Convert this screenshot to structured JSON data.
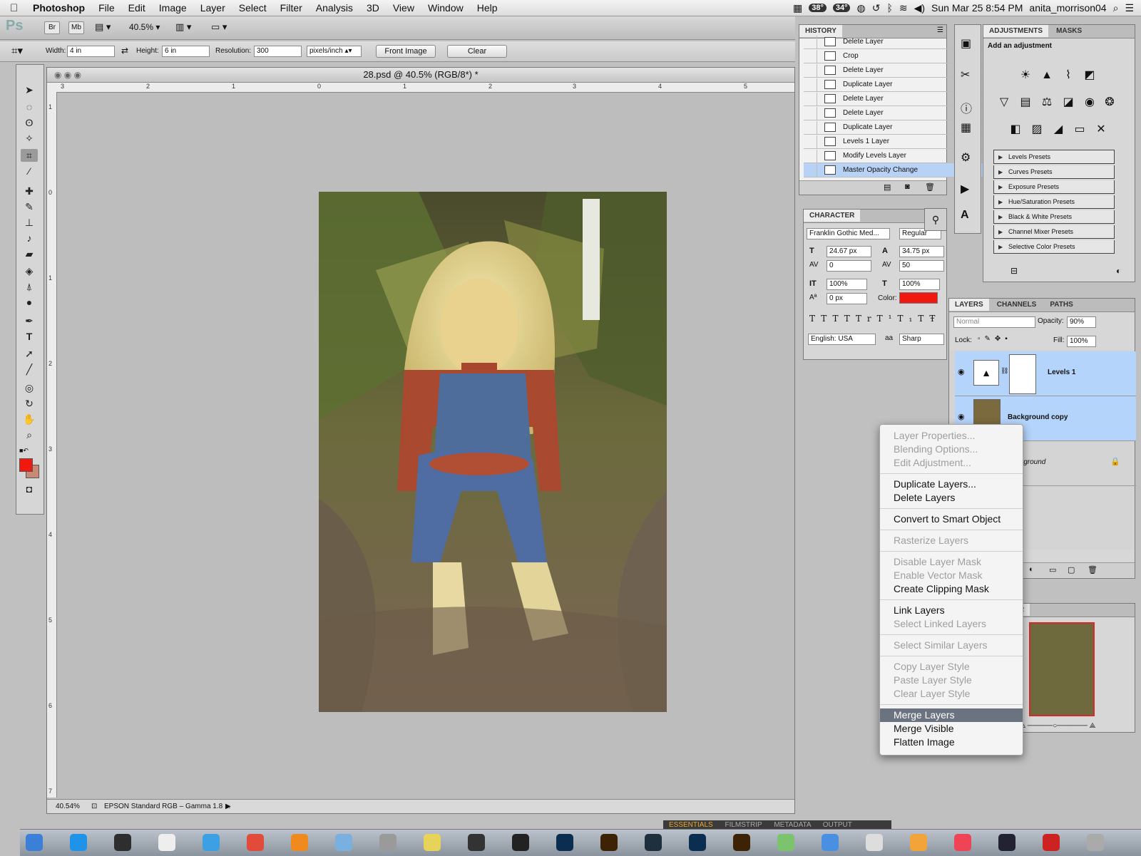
{
  "menubar": {
    "apple": "",
    "app_name": "Photoshop",
    "items": [
      "File",
      "Edit",
      "Image",
      "Layer",
      "Select",
      "Filter",
      "Analysis",
      "3D",
      "View",
      "Window",
      "Help"
    ],
    "status": {
      "temp1": "38°",
      "temp2": "34°",
      "datetime": "Sun Mar 25  8:54 PM",
      "user": "anita_morrison04"
    }
  },
  "appbar": {
    "logo": "Ps",
    "bridge": "Br",
    "minibridge": "Mb",
    "zoom": "40.5%"
  },
  "options": {
    "width_label": "Width:",
    "width_value": "4 in",
    "height_label": "Height:",
    "height_value": "6 in",
    "resolution_label": "Resolution:",
    "resolution_value": "300",
    "units": "pixels/inch",
    "front_image": "Front Image",
    "clear": "Clear"
  },
  "document": {
    "title": "28.psd @ 40.5% (RGB/8*) *",
    "ruler_h": [
      "3",
      "2",
      "1",
      "0",
      "1",
      "2",
      "3",
      "4",
      "5"
    ],
    "ruler_v": [
      "1",
      "0",
      "1",
      "2",
      "3",
      "4",
      "5",
      "6",
      "7"
    ],
    "status_zoom": "40.54%",
    "status_profile": "EPSON  Standard RGB – Gamma 1.8 ..."
  },
  "history": {
    "tab": "HISTORY",
    "items": [
      {
        "label": "Delete Layer"
      },
      {
        "label": "Crop"
      },
      {
        "label": "Delete Layer"
      },
      {
        "label": "Duplicate Layer"
      },
      {
        "label": "Delete Layer"
      },
      {
        "label": "Delete Layer"
      },
      {
        "label": "Duplicate Layer"
      },
      {
        "label": "Levels 1 Layer"
      },
      {
        "label": "Modify Levels Layer"
      },
      {
        "label": "Master Opacity Change"
      }
    ],
    "selected_index": 9
  },
  "character": {
    "tab": "CHARACTER",
    "font": "Franklin Gothic Med...",
    "style": "Regular",
    "size": "24.67 px",
    "leading": "34.75 px",
    "kerning": "0",
    "tracking": "50",
    "vscale": "100%",
    "hscale": "100%",
    "baseline": "0 px",
    "color_label": "Color:",
    "color": "#f0190f",
    "language": "English: USA",
    "aa_label": "aa",
    "antialias": "Sharp",
    "style_buttons": [
      "T",
      "T",
      "TT",
      "Tr",
      "T¹",
      "T₁",
      "T",
      "Ŧ"
    ]
  },
  "adjustments": {
    "tabs": [
      "ADJUSTMENTS",
      "MASKS"
    ],
    "subtitle": "Add an adjustment",
    "presets": [
      "Levels Presets",
      "Curves Presets",
      "Exposure Presets",
      "Hue/Saturation Presets",
      "Black & White Presets",
      "Channel Mixer Presets",
      "Selective Color Presets"
    ]
  },
  "layers": {
    "tabs": [
      "LAYERS",
      "CHANNELS",
      "PATHS"
    ],
    "blend_mode": "Normal",
    "opacity_label": "Opacity:",
    "opacity": "90%",
    "lock_label": "Lock:",
    "fill_label": "Fill:",
    "fill": "100%",
    "items": [
      {
        "name": "Levels 1",
        "selected": true
      },
      {
        "name": "Background copy",
        "selected": true
      },
      {
        "name": "Background",
        "selected": false
      }
    ]
  },
  "navigator": {
    "tab": "R"
  },
  "context_menu": {
    "items": [
      {
        "label": "Layer Properties...",
        "enabled": false
      },
      {
        "label": "Blending Options...",
        "enabled": false
      },
      {
        "label": "Edit Adjustment...",
        "enabled": false
      },
      {
        "label": "Duplicate Layers...",
        "enabled": true
      },
      {
        "label": "Delete Layers",
        "enabled": true
      },
      {
        "label": "Convert to Smart Object",
        "enabled": true
      },
      {
        "label": "Rasterize Layers",
        "enabled": false
      },
      {
        "label": "Disable Layer Mask",
        "enabled": false
      },
      {
        "label": "Enable Vector Mask",
        "enabled": false
      },
      {
        "label": "Create Clipping Mask",
        "enabled": true
      },
      {
        "label": "Link Layers",
        "enabled": true
      },
      {
        "label": "Select Linked Layers",
        "enabled": false
      },
      {
        "label": "Select Similar Layers",
        "enabled": false
      },
      {
        "label": "Copy Layer Style",
        "enabled": false
      },
      {
        "label": "Paste Layer Style",
        "enabled": false
      },
      {
        "label": "Clear Layer Style",
        "enabled": false
      },
      {
        "label": "Merge Layers",
        "enabled": true,
        "highlighted": true
      },
      {
        "label": "Merge Visible",
        "enabled": true
      },
      {
        "label": "Flatten Image",
        "enabled": true
      }
    ]
  },
  "bridge_tabs": [
    "ESSENTIALS",
    "FILMSTRIP",
    "METADATA",
    "OUTPUT"
  ],
  "dock": {
    "items": [
      "Finder",
      "App Store",
      "Dashboard",
      "Calendar 25",
      "Safari",
      "Chrome",
      "Firefox",
      "Preview",
      "Help",
      "Stickies",
      "Clock",
      "Steam",
      "Photoshop",
      "Bridge",
      "Lightroom",
      "Photoshop",
      "Bridge",
      "Photos",
      "Mail",
      "TextEdit",
      "Kindle",
      "Music",
      "Steam",
      "Acrobat",
      "Trash"
    ],
    "calendar_day": "25",
    "kindle_label": "kindle"
  },
  "colors": {
    "foreground": "#f0190f",
    "background": "#c98a73",
    "selection": "#b5d4fb"
  }
}
